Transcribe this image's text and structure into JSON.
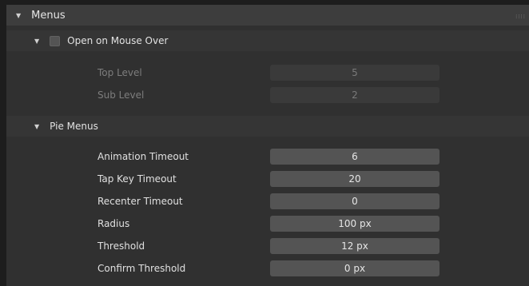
{
  "menus": {
    "title": "Menus",
    "open_on_mouse_over": {
      "label": "Open on Mouse Over",
      "checked": false,
      "rows": [
        {
          "label": "Top Level",
          "value": "5"
        },
        {
          "label": "Sub Level",
          "value": "2"
        }
      ]
    },
    "pie_menus": {
      "title": "Pie Menus",
      "rows": [
        {
          "label": "Animation Timeout",
          "value": "6"
        },
        {
          "label": "Tap Key Timeout",
          "value": "20"
        },
        {
          "label": "Recenter Timeout",
          "value": "0"
        },
        {
          "label": "Radius",
          "value": "100 px"
        },
        {
          "label": "Threshold",
          "value": "12 px"
        },
        {
          "label": "Confirm Threshold",
          "value": "0 px"
        }
      ]
    }
  },
  "icons": {
    "expand": "disclosure-triangle-down-icon",
    "drag": "drag-grip-icon"
  },
  "colors": {
    "panel_bg": "#303030",
    "header_bg": "#3d3d3d",
    "field_bg": "#545454",
    "field_disabled_bg": "#3a3a3a"
  }
}
